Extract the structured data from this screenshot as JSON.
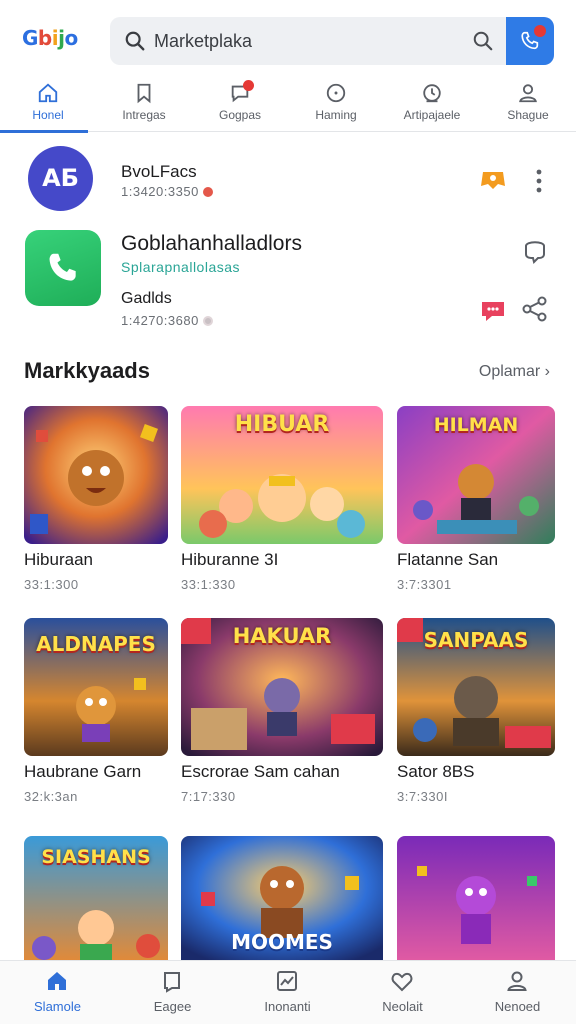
{
  "app": {
    "logo": [
      "G",
      "b",
      "i",
      "j",
      "o"
    ],
    "search_text": "Marketplaka"
  },
  "tabs": [
    {
      "label": "Honel",
      "icon": "home-icon",
      "active": true
    },
    {
      "label": "Intregas",
      "icon": "bookmark-icon",
      "active": false
    },
    {
      "label": "Gogpas",
      "icon": "chat-icon",
      "active": false
    },
    {
      "label": "Haming",
      "icon": "clock-icon",
      "active": false
    },
    {
      "label": "Artipajaele",
      "icon": "alarm-icon",
      "active": false
    },
    {
      "label": "Shague",
      "icon": "person-icon",
      "active": false
    }
  ],
  "contacts": [
    {
      "avatar": "AБ",
      "name": "BvoLFacs",
      "sub": "1:3420:3350"
    },
    {
      "name": "Goblahanhalladlors",
      "teal": "Splarapnallolasas",
      "name2": "Gadlds",
      "sub2": "1:4270:3680"
    }
  ],
  "section": {
    "title": "Markkyaads",
    "link": "Oplamar ›"
  },
  "games": [
    {
      "title": "Hiburaan",
      "sub": "33:1:300",
      "banner": ""
    },
    {
      "title": "Hiburanne 3I",
      "sub": "33:1:330",
      "banner": "HIBUAR"
    },
    {
      "title": "Flatanne San",
      "sub": "3:7:3301",
      "banner": "HILMAN"
    },
    {
      "title": "Haubrane Garn",
      "sub": "32:k:3an",
      "banner": "ALDNAPES"
    },
    {
      "title": "Escrorae Sam cahan",
      "sub": "7:17:330",
      "banner": "HAKUAR"
    },
    {
      "title": "Sator 8BS",
      "sub": "3:7:330I",
      "banner": "SANPAAS"
    },
    {
      "title": "",
      "sub": "",
      "banner": "SIASHANS"
    },
    {
      "title": "",
      "sub": "",
      "banner": "MOOMES"
    },
    {
      "title": "",
      "sub": "",
      "banner": ""
    }
  ],
  "bottom_nav": [
    {
      "label": "Slamole",
      "icon": "home-icon",
      "active": true
    },
    {
      "label": "Eagee",
      "icon": "bookmark-icon",
      "active": false
    },
    {
      "label": "Inonanti",
      "icon": "card-icon",
      "active": false
    },
    {
      "label": "Neolait",
      "icon": "heart-icon",
      "active": false
    },
    {
      "label": "Nenoed",
      "icon": "person-icon",
      "active": false
    }
  ],
  "colors": {
    "accent": "#2f6fd8",
    "badge": "#e53935",
    "avatar": "#4549c9",
    "phone": "#22b05b"
  }
}
